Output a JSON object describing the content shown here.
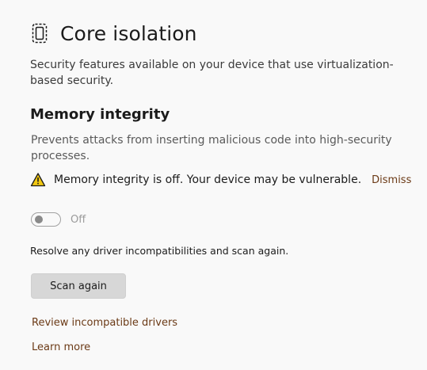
{
  "header": {
    "icon": "core-isolation-chip-icon",
    "title": "Core isolation"
  },
  "description": "Security features available on your device that use virtualization-based security.",
  "memory_integrity": {
    "title": "Memory integrity",
    "description": "Prevents attacks from inserting malicious code into high-security processes.",
    "warning": {
      "icon": "warning-triangle-icon",
      "text": "Memory integrity is off. Your device may be vulnerable.",
      "dismiss_label": "Dismiss",
      "icon_color": "#f2c811"
    },
    "toggle": {
      "state": "Off",
      "on": false,
      "disabled": true
    }
  },
  "resolve_text": "Resolve any driver incompatibilities and scan again.",
  "scan_button_label": "Scan again",
  "links": {
    "review_drivers": "Review incompatible drivers",
    "learn_more": "Learn more"
  },
  "colors": {
    "link": "#6b3a16",
    "background": "#f9f9f9"
  }
}
